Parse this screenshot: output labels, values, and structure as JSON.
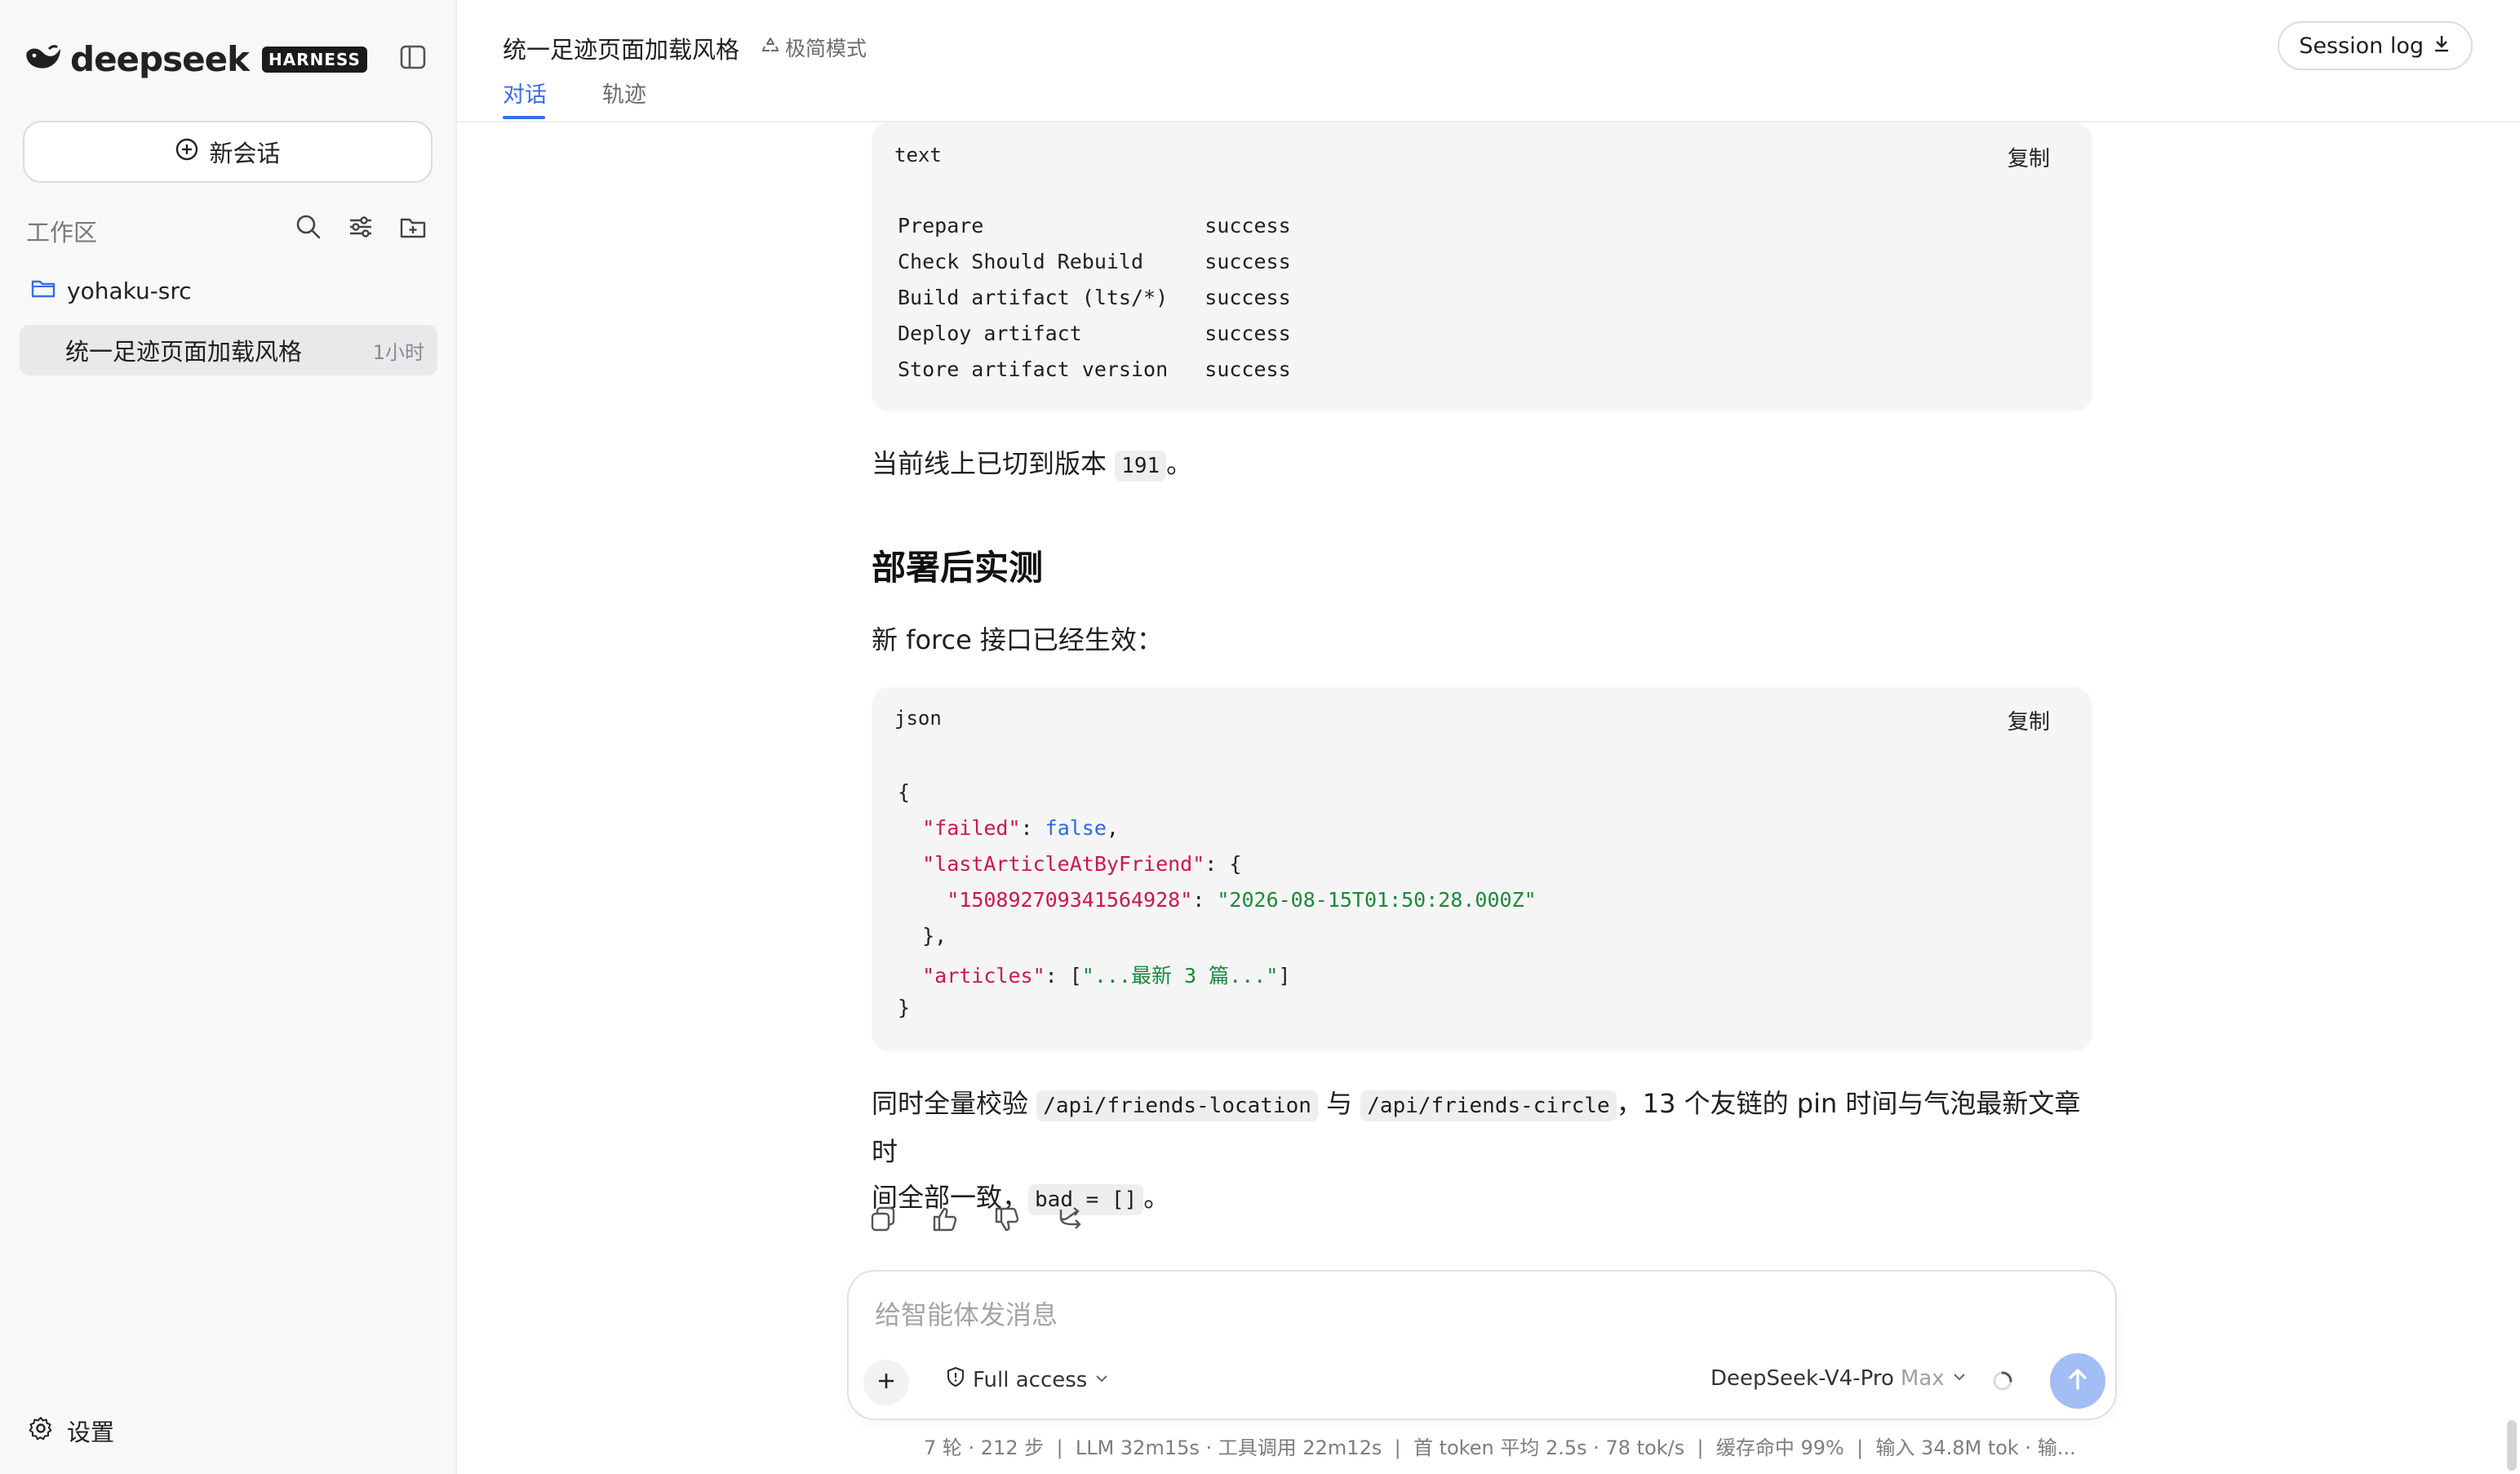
{
  "sidebar": {
    "logo_text": "deepseek",
    "logo_badge": "HARNESS",
    "new_chat_label": "新会话",
    "workspace_label": "工作区",
    "folder_name": "yohaku-src",
    "session": {
      "title": "统一足迹页面加载风格",
      "time": "1小时"
    },
    "settings_label": "设置"
  },
  "header": {
    "title": "统一足迹页面加载风格",
    "mode_label": "极简模式",
    "tabs": [
      {
        "label": "对话",
        "active": true
      },
      {
        "label": "轨迹",
        "active": false
      }
    ],
    "session_log_label": "Session log"
  },
  "content": {
    "code1": {
      "lang": "text",
      "copy_label": "复制",
      "lines": [
        "Prepare                  success",
        "Check Should Rebuild     success",
        "Build artifact (lts/*)   success",
        "Deploy artifact          success",
        "Store artifact version   success"
      ]
    },
    "para1": {
      "before": "当前线上已切到版本",
      "code": "191",
      "after": "。"
    },
    "heading": "部署后实测",
    "para2": "新 force 接口已经生效：",
    "code2": {
      "lang": "json",
      "copy_label": "复制",
      "open": "{",
      "failed_key": "\"failed\"",
      "failed_val": "false",
      "last_key": "\"lastArticleAtByFriend\"",
      "friend_key": "\"150892709341564928\"",
      "friend_val": "\"2026-08-15T01:50:28.000Z\"",
      "inner_close": "},",
      "articles_key": "\"articles\"",
      "articles_val": "\"...最新 3 篇...\"",
      "close": "}"
    },
    "para3": {
      "t1": "同时全量校验",
      "c1": "/api/friends-location",
      "t2": "与",
      "c2": "/api/friends-circle",
      "t3": "，13 个友链的 pin 时间与气泡最新文章时",
      "t4": "间全部一致，",
      "c3": "bad = []",
      "t5": "。"
    }
  },
  "composer": {
    "placeholder": "给智能体发消息",
    "access_label": "Full access",
    "model_name": "DeepSeek-V4-Pro",
    "model_tier": "Max"
  },
  "stats": "7 轮 · 212 步  |  LLM 32m15s · 工具调用 22m12s  |  首 token 平均 2.5s · 78 tok/s  |  缓存命中 99%  |  输入 34.8M tok · 输...",
  "colors": {
    "accent": "#3b6ce8",
    "json_key": "#c9184a",
    "json_bool": "#2f6ad9",
    "json_string": "#1a8a3a"
  }
}
